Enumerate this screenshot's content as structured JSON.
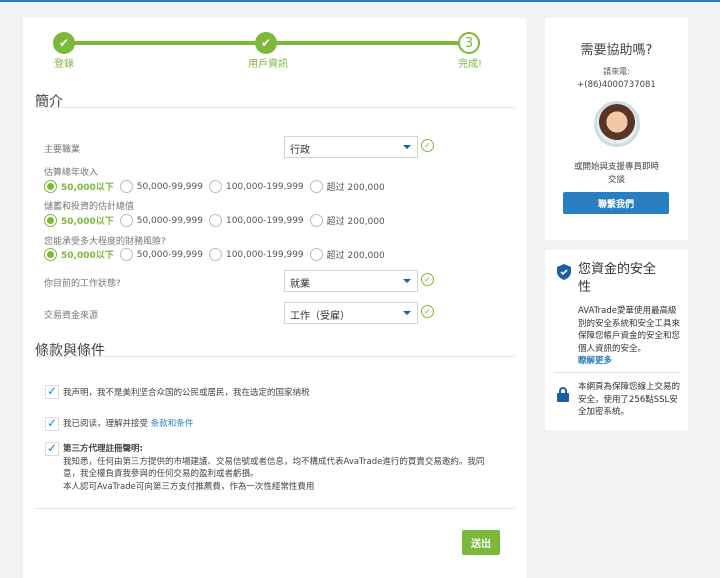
{
  "progress": {
    "steps": [
      {
        "label": "登錄",
        "state": "done"
      },
      {
        "label": "用戶資訊",
        "state": "done"
      },
      {
        "label": "完成!",
        "number": "3",
        "state": "current"
      }
    ]
  },
  "profile": {
    "heading": "簡介",
    "occupation": {
      "label": "主要職業",
      "value": "行政"
    },
    "income": {
      "label": "估算總年收入",
      "options": [
        "50,000以下",
        "50,000-99,999",
        "100,000-199,999",
        "超过 200,000"
      ],
      "selected": 0
    },
    "savings": {
      "label": "儲蓄和投資的估計總值",
      "options": [
        "50,000以下",
        "50,000-99,999",
        "100,000-199,999",
        "超过 200,000"
      ],
      "selected": 0
    },
    "risk": {
      "label": "您能承受多大程度的財務風險?",
      "options": [
        "50,000以下",
        "50,000-99,999",
        "100,000-199,999",
        "超过 200,000"
      ],
      "selected": 0
    },
    "employment": {
      "label": "你目前的工作狀態?",
      "value": "就業"
    },
    "funds": {
      "label": "交易資金來源",
      "value": "工作（受雇）"
    }
  },
  "terms": {
    "heading": "條款與條件",
    "item1": "我声明，我不是美利坚合众国的公民或居民，我在选定的国家纳税",
    "item2_text": "我已阅读，理解并接受",
    "item2_link": "条款和条件",
    "item3_title": "第三方代理註冊聲明:",
    "item3_line1": "我知悉，任何由第三方提供的市場建議、交易信號或者信息，均不構成代表AvaTrade進行的買賣交易邀約。我同",
    "item3_line2": "意，我全權負責我參與的任何交易的盈利或者虧損。",
    "item3_line3": "本人認可AvaTrade可向第三方支付推薦費，作為一次性經常性費用"
  },
  "submit_label": "送出",
  "help": {
    "title": "需要協助嗎?",
    "call_label": "請來電:",
    "phone": "+(86)4000737081",
    "chat_line1": "或開始與支援專員即時",
    "chat_line2": "交談",
    "button": "聯繫我們"
  },
  "security": {
    "title_line1": "您資金的安全",
    "title_line2": "性",
    "body": "AVATrade愛華使用最高級別的安全系統和安全工具來保障您帳戶資金的安全和您個人資訊的安全。",
    "link": "瞭解更多",
    "ssl": "本網頁為保障您線上交易的安全，使用了256點SSL安全加密系統。"
  },
  "colors": {
    "green": "#7cb83a",
    "blue": "#2a7fc0"
  }
}
